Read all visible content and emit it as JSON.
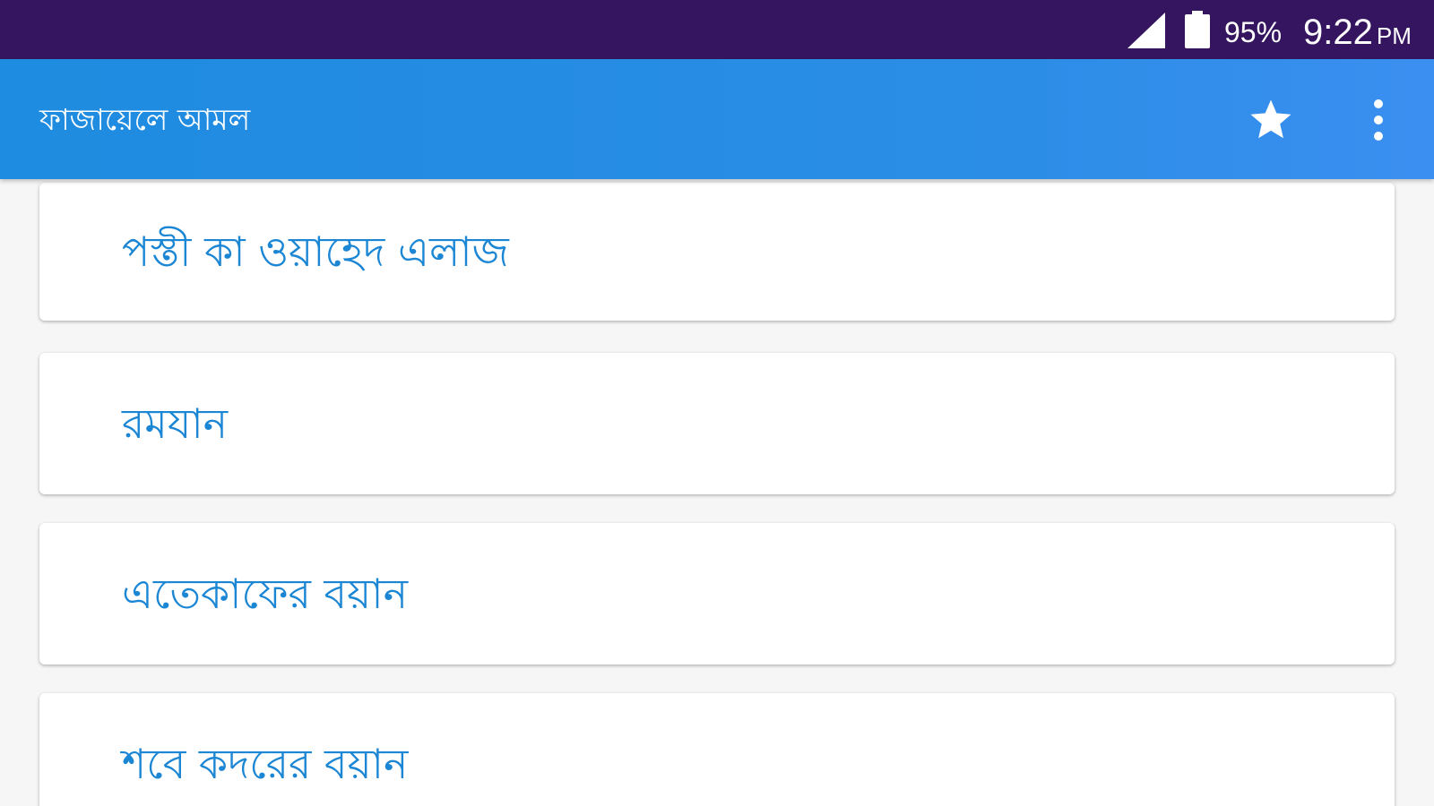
{
  "status_bar": {
    "battery_percent": "95%",
    "time": "9:22",
    "ampm": "PM",
    "background_color": "#35155f"
  },
  "app_bar": {
    "title": "ফাজায়েলে আমল",
    "background_color": "#1e8ce0",
    "actions": [
      "star-icon",
      "more-vert-icon"
    ]
  },
  "list": {
    "items": [
      {
        "label": "পস্তী কা ওয়াহেদ এলাজ"
      },
      {
        "label": "রমযান"
      },
      {
        "label": "এতেকাফের বয়ান"
      },
      {
        "label": "শবে কদরের বয়ান"
      }
    ],
    "text_color": "#1b86d4"
  }
}
